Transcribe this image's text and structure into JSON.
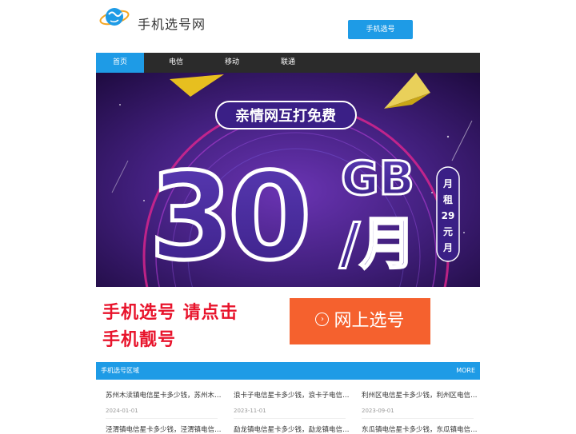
{
  "header": {
    "site_name": "手机选号网",
    "top_button": "手机选号",
    "logo": "globe-logo-icon"
  },
  "nav": {
    "items": [
      {
        "label": "首页",
        "active": true
      },
      {
        "label": "电信",
        "active": false
      },
      {
        "label": "移动",
        "active": false
      },
      {
        "label": "联通",
        "active": false
      }
    ]
  },
  "banner": {
    "pill": "亲情网互打免费",
    "big_number": "30",
    "unit_top": "GB",
    "unit_bottom": "/月",
    "side_chars": [
      "月",
      "租",
      "29",
      "元",
      "月"
    ],
    "colors": {
      "bg_dark": "#2a0f55",
      "bg_mid": "#5b2a9c",
      "text_fill": "#4a2a9a",
      "accent_yellow": "#f1c81b",
      "arc_pink": "#e0258f"
    }
  },
  "promo": {
    "line1": "手机选号  请点击",
    "line2": "手机靓号",
    "button_icon": "›",
    "button_label": "网上选号",
    "colors": {
      "text_red": "#e8142c",
      "button_orange": "#f5612e"
    }
  },
  "section": {
    "title": "手机选号区域",
    "more": "MORE",
    "cards": [
      {
        "title": "苏州木渎镇电信星卡多少钱，苏州木渎镇电信星卡",
        "date": "2024-01-01"
      },
      {
        "title": "浪卡子电信星卡多少钱，浪卡子电信星卡",
        "date": "2023-11-01"
      },
      {
        "title": "利州区电信星卡多少钱，利州区电信星卡",
        "date": "2023-09-01"
      },
      {
        "title": "泾渭镇电信星卡多少钱，泾渭镇电信星卡",
        "date": ""
      },
      {
        "title": "勐龙镇电信星卡多少钱，勐龙镇电信星卡",
        "date": ""
      },
      {
        "title": "东瓜镇电信星卡多少钱，东瓜镇电信星卡",
        "date": ""
      }
    ]
  },
  "colors": {
    "primary": "#1e9be6",
    "nav_bg": "#2b2b2b"
  }
}
